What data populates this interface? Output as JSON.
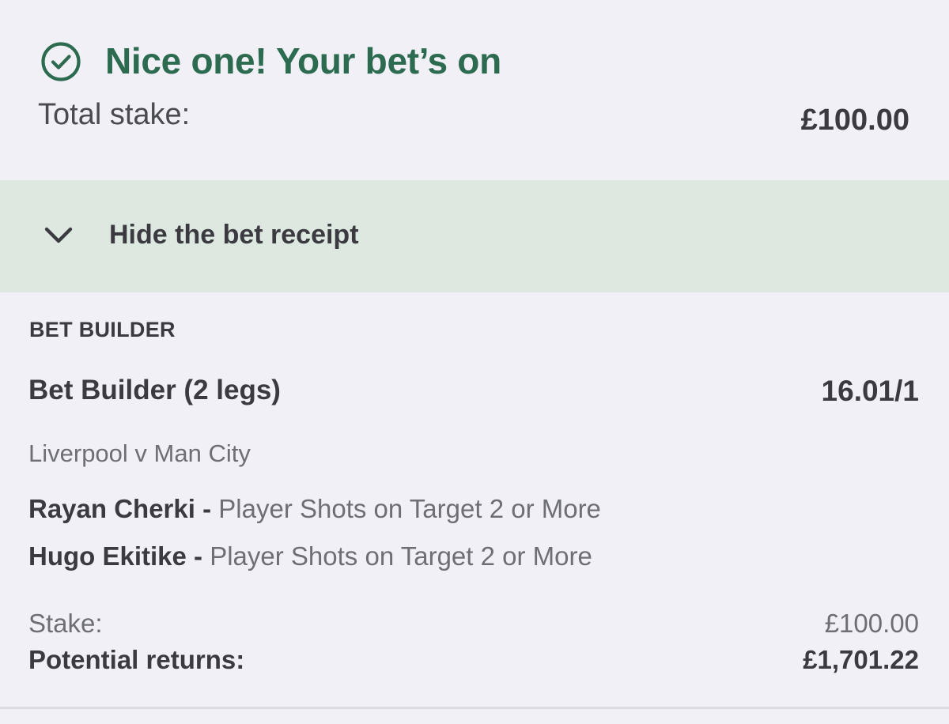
{
  "confirmation": {
    "icon": "check-circle-icon",
    "title": "Nice one! Your bet’s on",
    "total_stake_label": "Total stake:",
    "total_stake_value": "£100.00"
  },
  "receipt_toggle": {
    "icon": "chevron-down-icon",
    "label": "Hide the bet receipt"
  },
  "receipt": {
    "section_title": "BET BUILDER",
    "bet_name": "Bet Builder (2 legs)",
    "odds": "16.01/1",
    "event": "Liverpool v Man City",
    "selections": [
      {
        "player": "Rayan Cherki",
        "separator": " - ",
        "market": "Player Shots on Target 2 or More"
      },
      {
        "player": "Hugo Ekitike",
        "separator": " - ",
        "market": "Player Shots on Target 2 or More"
      }
    ],
    "stake_label": "Stake:",
    "stake_value": "£100.00",
    "returns_label": "Potential returns:",
    "returns_value": "£1,701.22"
  },
  "colors": {
    "background": "#f1f0f6",
    "success_green": "#2c6b4f",
    "toggle_bar": "#dde8e0",
    "text_dark": "#3a3a40",
    "text_muted": "#6e6e76"
  }
}
